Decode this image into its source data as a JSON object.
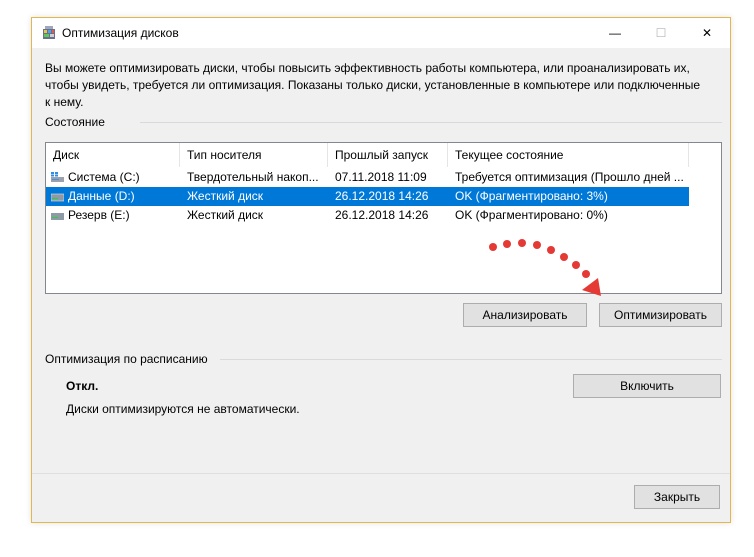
{
  "window": {
    "title": "Оптимизация дисков",
    "minimize_glyph": "—",
    "maximize_glyph": "☐",
    "close_glyph": "✕"
  },
  "description": "Вы можете оптимизировать диски, чтобы повысить эффективность работы  компьютера, или проанализировать их, чтобы увидеть, требуется ли оптимизация. Показаны только диски, установленные в компьютере или подключенные к нему.",
  "status": {
    "label": "Состояние",
    "columns": [
      "Диск",
      "Тип носителя",
      "Прошлый запуск",
      "Текущее состояние"
    ],
    "rows": [
      {
        "disk": "Система (C:)",
        "media": "Твердотельный накоп...",
        "last_run": "07.11.2018 11:09",
        "state": "Требуется оптимизация (Прошло дней ...",
        "icon": "windows-drive-icon",
        "selected": false
      },
      {
        "disk": "Данные (D:)",
        "media": "Жесткий диск",
        "last_run": "26.12.2018 14:26",
        "state": "OK (Фрагментировано: 3%)",
        "icon": "hard-drive-icon",
        "selected": true
      },
      {
        "disk": "Резерв (E:)",
        "media": "Жесткий диск",
        "last_run": "26.12.2018 14:26",
        "state": "OK (Фрагментировано: 0%)",
        "icon": "hard-drive-icon",
        "selected": false
      }
    ]
  },
  "actions": {
    "analyze_label": "Анализировать",
    "optimize_label": "Оптимизировать"
  },
  "schedule": {
    "label": "Оптимизация по расписанию",
    "state": "Откл.",
    "note": "Диски оптимизируются не автоматически.",
    "enable_label": "Включить"
  },
  "footer": {
    "close_label": "Закрыть"
  },
  "colors": {
    "selection": "#0078d7",
    "annotation": "#e53935",
    "window_border": "#e0b84c"
  }
}
